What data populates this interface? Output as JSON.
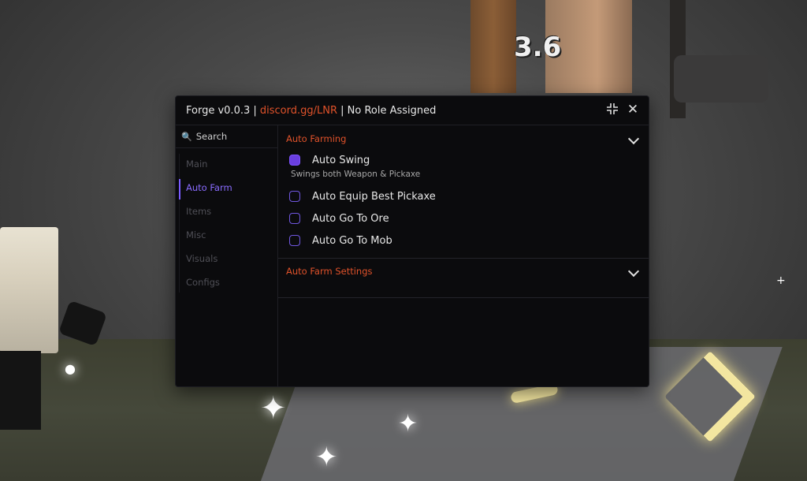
{
  "game": {
    "damage_number": "3.6"
  },
  "window": {
    "title_prefix": "Forge v0.0.3 | ",
    "title_link": "discord.gg/LNR",
    "title_suffix": " | No Role Assigned",
    "minimize_icon": "compress-icon",
    "close_icon": "close-icon"
  },
  "sidebar": {
    "search_placeholder": "Search",
    "items": [
      {
        "label": "Main",
        "active": false
      },
      {
        "label": "Auto Farm",
        "active": true
      },
      {
        "label": "Items",
        "active": false
      },
      {
        "label": "Misc",
        "active": false
      },
      {
        "label": "Visuals",
        "active": false
      },
      {
        "label": "Configs",
        "active": false
      }
    ]
  },
  "sections": [
    {
      "title": "Auto Farming",
      "toggles": [
        {
          "label": "Auto Swing",
          "checked": true,
          "description": "Swings both Weapon & Pickaxe"
        },
        {
          "label": "Auto Equip Best Pickaxe",
          "checked": false
        },
        {
          "label": "Auto Go To Ore",
          "checked": false
        },
        {
          "label": "Auto Go To Mob",
          "checked": false
        }
      ]
    },
    {
      "title": "Auto Farm Settings",
      "toggles": []
    }
  ],
  "colors": {
    "accent": "#7b5cff",
    "link": "#e0522a",
    "window_bg": "#0b0b0d"
  }
}
